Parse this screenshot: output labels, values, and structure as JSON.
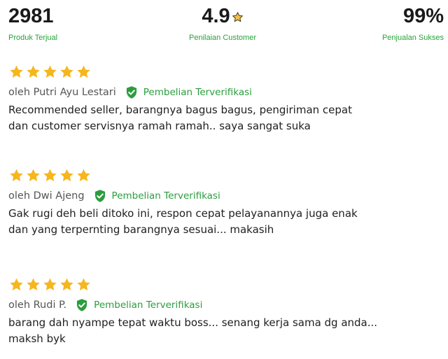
{
  "stats": [
    {
      "value": "2981",
      "label": "Produk Terjual"
    },
    {
      "value": "4.9",
      "label": "Penilaian Customer"
    },
    {
      "value": "99%",
      "label": "Penjualan Sukses"
    }
  ],
  "reviews": [
    {
      "rating": 5,
      "name": "oleh Putri Ayu Lestari",
      "badge": "Pembelian Terverifikasi",
      "line1": "Recommended seller, barangnya bagus bagus, pengiriman cepat",
      "line2": "dan customer servisnya ramah ramah.. saya sangat suka"
    },
    {
      "rating": 5,
      "name": "oleh Dwi Ajeng",
      "badge": "Pembelian Terverifikasi",
      "line1": "Gak rugi deh beli ditoko ini, respon cepat pelayanannya juga enak",
      "line2": "dan yang terpernting barangnya sesuai... makasih"
    },
    {
      "rating": 5,
      "name": "oleh Rudi P.",
      "badge": "Pembelian Terverifikasi",
      "line1": "barang dah nyampe tepat waktu boss... senang kerja sama dg anda...",
      "line2": "maksh byk"
    }
  ],
  "colors": {
    "star": "#f6b61c",
    "verified": "#2c9d3e",
    "label": "#26a43a"
  },
  "icons": {
    "rating_star": "star-icon",
    "verified": "verified-check-icon"
  }
}
